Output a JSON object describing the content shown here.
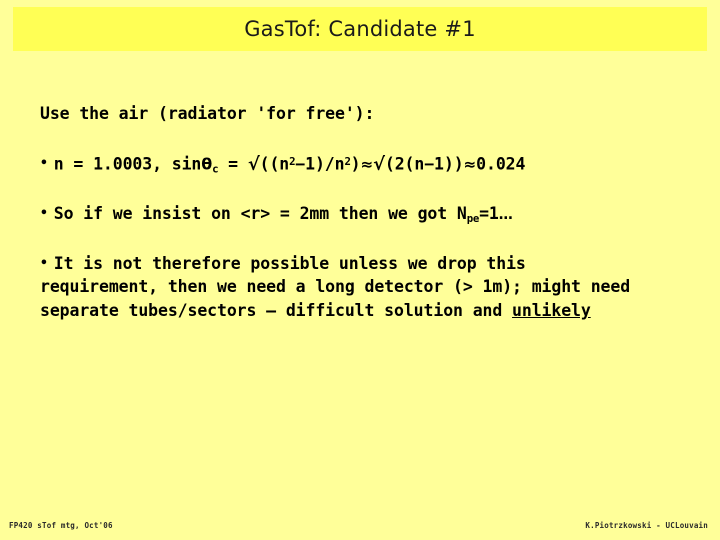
{
  "slide": {
    "background_color": "#ffff99",
    "title_band_color": "#ffff55",
    "text_color": "#000000",
    "title": "GasTof: Candidate #1"
  },
  "body": {
    "intro": "Use the air (radiator 'for free'):",
    "bullet_marker": "•",
    "bullet1": {
      "prefix": "n = 1.0003, sin",
      "theta": "θ",
      "theta_sub": "c",
      "equals": " = ",
      "radical1": "√",
      "expr1_a": "((n",
      "expr1_sup1": "2",
      "expr1_b": "−1)/n",
      "expr1_sup2": "2",
      "expr1_c": ")",
      "approx1": "≈",
      "radical2": "√",
      "expr2": "(2(n−1))",
      "approx2": "≈",
      "value": "0.024"
    },
    "bullet2": {
      "prefix": "So if we insist on <r> = 2mm then we got N",
      "sub": "pe",
      "suffix": "=1",
      "ellipsis": "…"
    },
    "bullet3": {
      "part1": "It is not therefore possible unless we drop this requirement, then we need a long detector (> 1m); might need separate tubes/sectors – difficult solution and ",
      "underlined": "unlikely"
    }
  },
  "footer": {
    "left": "FP420 sTof  mtg, Oct'06",
    "right": "K.Piotrzkowski - UCLouvain"
  }
}
